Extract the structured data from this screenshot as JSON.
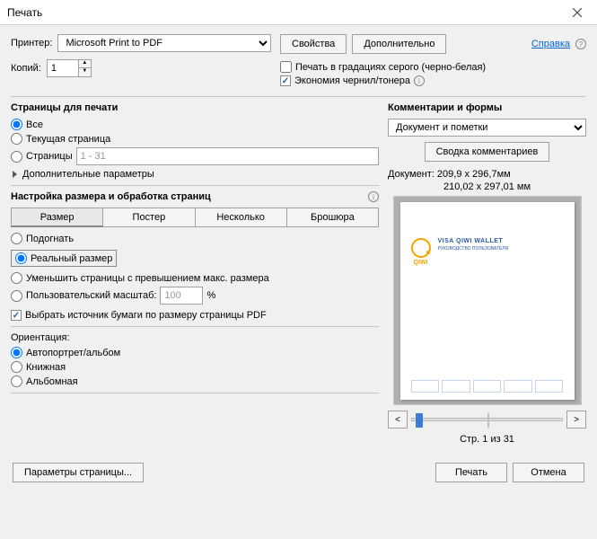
{
  "title": "Печать",
  "toprow": {
    "printer_label": "Принтер:",
    "printer_value": "Microsoft Print to PDF",
    "copies_label": "Копий:",
    "copies_value": "1",
    "props_btn": "Свойства",
    "advanced_btn": "Дополнительно",
    "help_link": "Справка",
    "grayscale": "Печать в градациях серого (черно-белая)",
    "ink_save": "Экономия чернил/тонера"
  },
  "pages": {
    "title": "Страницы для печати",
    "all": "Все",
    "current": "Текущая страница",
    "range_label": "Страницы",
    "range_value": "1 - 31",
    "more": "Дополнительные параметры"
  },
  "sizing": {
    "title": "Настройка размера и обработка страниц",
    "tab_size": "Размер",
    "tab_poster": "Постер",
    "tab_multiple": "Несколько",
    "tab_booklet": "Брошюра",
    "fit": "Подогнать",
    "actual": "Реальный размер",
    "shrink": "Уменьшить страницы с превышением макс. размера",
    "custom": "Пользовательский масштаб:",
    "custom_value": "100",
    "percent": "%",
    "paper_source": "Выбрать источник бумаги по размеру страницы PDF"
  },
  "orientation": {
    "title": "Ориентация:",
    "auto": "Автопортрет/альбом",
    "portrait": "Книжная",
    "landscape": "Альбомная"
  },
  "comments": {
    "title": "Комментарии и формы",
    "combo": "Документ и пометки",
    "summary_btn": "Сводка комментариев"
  },
  "preview": {
    "doc_dims": "Документ: 209,9 x 296,7мм",
    "paper_dims": "210,02 x 297,01 мм",
    "qiwi": "QIWI",
    "wallet": "VISA QIWI WALLET",
    "sub": "РУКОВОДСТВО ПОЛЬЗОВАТЕЛЯ",
    "page_of": "Стр. 1 из 31"
  },
  "bottom": {
    "page_setup": "Параметры страницы...",
    "print": "Печать",
    "cancel": "Отмена"
  }
}
